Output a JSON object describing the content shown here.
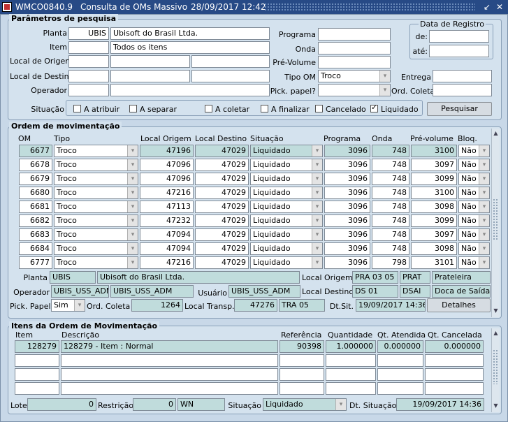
{
  "window": {
    "title_code": "WMCO0840.9",
    "title_name": "Consulta de OMs Massivo",
    "title_datetime": "28/09/2017 12:42",
    "restore_glyph": "↙",
    "close_glyph": "✕"
  },
  "search": {
    "title": "Parâmetros de pesquisa",
    "planta_label": "Planta",
    "planta_code": "UBIS",
    "planta_name": "Ubisoft do Brasil Ltda.",
    "item_label": "Item",
    "item_code": "",
    "item_name": "Todos os itens",
    "local_origem_label": "Local de Origem",
    "local_destino_label": "Local de Destino",
    "operador_label": "Operador",
    "programa_label": "Programa",
    "onda_label": "Onda",
    "pre_volume_label": "Pré-Volume",
    "tipo_om_label": "Tipo OM",
    "tipo_om_value": "Troco",
    "pick_papel_label": "Pick. papel?",
    "entrega_label": "Entrega",
    "ord_coleta_label": "Ord. Coleta",
    "data_registro_label": "Data de Registro",
    "de_label": "de:",
    "ate_label": "até:",
    "situacao_label": "Situação",
    "checkboxes": [
      {
        "label": "A atribuir",
        "checked": false
      },
      {
        "label": "A separar",
        "checked": false
      },
      {
        "label": "A coletar",
        "checked": false
      },
      {
        "label": "A finalizar",
        "checked": false
      },
      {
        "label": "Cancelado",
        "checked": false
      },
      {
        "label": "Liquidado",
        "checked": true
      }
    ],
    "pesquisar_label": "Pesquisar"
  },
  "orders": {
    "title": "Ordem de movimentação",
    "columns": [
      "OM",
      "Tipo",
      "Local Origem",
      "Local Destino",
      "Situação",
      "Programa",
      "Onda",
      "Pré-volume",
      "Bloq."
    ],
    "rows": [
      {
        "om": "6677",
        "tipo": "Troco",
        "origem": "47196",
        "destino": "47029",
        "situacao": "Liquidado",
        "programa": "3096",
        "onda": "748",
        "pre_volume": "3100",
        "bloq": "Não"
      },
      {
        "om": "6678",
        "tipo": "Troco",
        "origem": "47096",
        "destino": "47029",
        "situacao": "Liquidado",
        "programa": "3096",
        "onda": "748",
        "pre_volume": "3097",
        "bloq": "Não"
      },
      {
        "om": "6679",
        "tipo": "Troco",
        "origem": "47096",
        "destino": "47029",
        "situacao": "Liquidado",
        "programa": "3096",
        "onda": "748",
        "pre_volume": "3099",
        "bloq": "Não"
      },
      {
        "om": "6680",
        "tipo": "Troco",
        "origem": "47216",
        "destino": "47029",
        "situacao": "Liquidado",
        "programa": "3096",
        "onda": "748",
        "pre_volume": "3100",
        "bloq": "Não"
      },
      {
        "om": "6681",
        "tipo": "Troco",
        "origem": "47113",
        "destino": "47029",
        "situacao": "Liquidado",
        "programa": "3096",
        "onda": "748",
        "pre_volume": "3098",
        "bloq": "Não"
      },
      {
        "om": "6682",
        "tipo": "Troco",
        "origem": "47232",
        "destino": "47029",
        "situacao": "Liquidado",
        "programa": "3096",
        "onda": "748",
        "pre_volume": "3099",
        "bloq": "Não"
      },
      {
        "om": "6683",
        "tipo": "Troco",
        "origem": "47094",
        "destino": "47029",
        "situacao": "Liquidado",
        "programa": "3096",
        "onda": "748",
        "pre_volume": "3097",
        "bloq": "Não"
      },
      {
        "om": "6684",
        "tipo": "Troco",
        "origem": "47094",
        "destino": "47029",
        "situacao": "Liquidado",
        "programa": "3096",
        "onda": "748",
        "pre_volume": "3098",
        "bloq": "Não"
      },
      {
        "om": "6777",
        "tipo": "Troco",
        "origem": "47216",
        "destino": "47029",
        "situacao": "Liquidado",
        "programa": "3096",
        "onda": "798",
        "pre_volume": "3101",
        "bloq": "Não"
      }
    ]
  },
  "details": {
    "planta_label": "Planta",
    "planta_code": "UBIS",
    "planta_name": "Ubisoft do Brasil Ltda.",
    "local_origem_label": "Local Origem",
    "local_origem_code": "PRA 03 05",
    "local_origem_short": "PRAT",
    "local_origem_desc": "Prateleira",
    "operador_label": "Operador",
    "operador_code": "UBIS_USS_ADM",
    "operador_name": "UBIS_USS_ADM",
    "usuario_label": "Usuário",
    "usuario_value": "UBIS_USS_ADM",
    "local_destino_label": "Local Destino",
    "local_destino_code": "DS 01",
    "local_destino_short": "DSAI",
    "local_destino_desc": "Doca de Saída",
    "pick_papel_label": "Pick. Papel?",
    "pick_papel_value": "Sim",
    "ord_coleta_label": "Ord. Coleta",
    "ord_coleta_value": "1264",
    "local_transp_label": "Local Transp.",
    "local_transp_code": "47276",
    "local_transp_name": "TRA 05",
    "dt_sit_label": "Dt.Sit.",
    "dt_sit_value": "19/09/2017 14:36",
    "detalhes_label": "Detalhes"
  },
  "items": {
    "title": "Itens da Ordem de Movimentação",
    "columns": [
      "Item",
      "Descrição",
      "Referência",
      "Quantidade",
      "Qt. Atendida",
      "Qt. Cancelada"
    ],
    "rows": [
      {
        "item": "128279",
        "descricao": "128279 - Item : Normal",
        "referencia": "90398",
        "quantidade": "1.000000",
        "qt_atendida": "0.000000",
        "qt_cancelada": "0.000000"
      },
      {
        "item": "",
        "descricao": "",
        "referencia": "",
        "quantidade": "",
        "qt_atendida": "",
        "qt_cancelada": ""
      },
      {
        "item": "",
        "descricao": "",
        "referencia": "",
        "quantidade": "",
        "qt_atendida": "",
        "qt_cancelada": ""
      },
      {
        "item": "",
        "descricao": "",
        "referencia": "",
        "quantidade": "",
        "qt_atendida": "",
        "qt_cancelada": ""
      }
    ],
    "lote_label": "Lote",
    "lote_value": "0",
    "restricao_label": "Restrição",
    "restricao_value": "0",
    "restricao_code": "WN",
    "situacao_label": "Situação",
    "situacao_value": "Liquidado",
    "dt_situacao_label": "Dt. Situação",
    "dt_situacao_value": "19/09/2017 14:36"
  }
}
